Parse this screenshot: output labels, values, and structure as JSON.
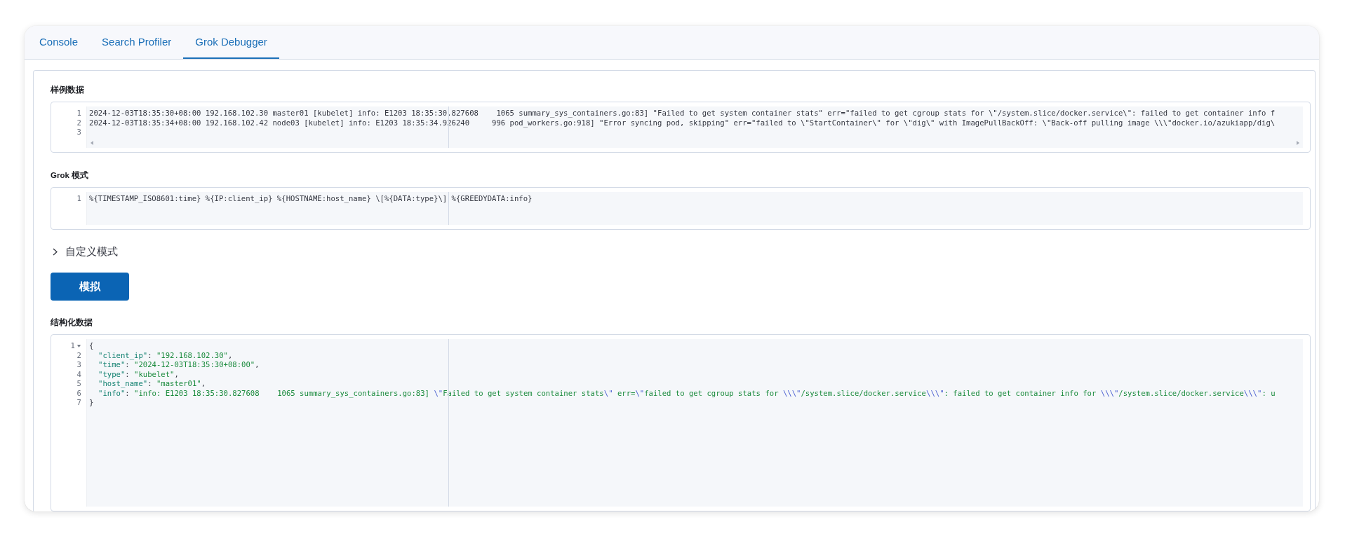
{
  "tabs": [
    {
      "label": "Console",
      "selected": false
    },
    {
      "label": "Search Profiler",
      "selected": false
    },
    {
      "label": "Grok Debugger",
      "selected": true
    }
  ],
  "sample_data": {
    "label": "样例数据",
    "lines": [
      {
        "number": "1",
        "text": "2024-12-03T18:35:30+08:00 192.168.102.30 master01 [kubelet] info: E1203 18:35:30.827608    1065 summary_sys_containers.go:83] \"Failed to get system container stats\" err=\"failed to get cgroup stats for \\\"/system.slice/docker.service\\\": failed to get container info f"
      },
      {
        "number": "2",
        "text": "2024-12-03T18:35:34+08:00 192.168.102.42 node03 [kubelet] info: E1203 18:35:34.926240     996 pod_workers.go:918] \"Error syncing pod, skipping\" err=\"failed to \\\"StartContainer\\\" for \\\"dig\\\" with ImagePullBackOff: \\\"Back-off pulling image \\\\\\\"docker.io/azukiapp/dig\\"
      },
      {
        "number": "3"
      }
    ]
  },
  "grok_pattern": {
    "label": "Grok 模式",
    "lines": [
      {
        "number": "1",
        "text": "%{TIMESTAMP_ISO8601:time} %{IP:client_ip} %{HOSTNAME:host_name} \\[%{DATA:type}\\] %{GREEDYDATA:info}"
      }
    ]
  },
  "custom_patterns": {
    "label": "自定义模式",
    "expanded": false
  },
  "simulate_button": {
    "label": "模拟"
  },
  "structured_data": {
    "label": "结构化数据",
    "lines": [
      {
        "number": "1",
        "expanded": true,
        "tokens": [
          {
            "kind": "punct",
            "text": "{"
          }
        ],
        "children": [
          {
            "number": "2",
            "tokens": [
              {
                "kind": "key",
                "text": "\"client_ip\""
              },
              {
                "kind": "punct",
                "text": ": "
              },
              {
                "kind": "string",
                "text": "\"192.168.102.30\""
              },
              {
                "kind": "punct",
                "text": ","
              }
            ]
          },
          {
            "number": "3",
            "tokens": [
              {
                "kind": "key",
                "text": "\"time\""
              },
              {
                "kind": "punct",
                "text": ": "
              },
              {
                "kind": "string",
                "text": "\"2024-12-03T18:35:30+08:00\""
              },
              {
                "kind": "punct",
                "text": ","
              }
            ]
          },
          {
            "number": "4",
            "tokens": [
              {
                "kind": "key",
                "text": "\"type\""
              },
              {
                "kind": "punct",
                "text": ": "
              },
              {
                "kind": "string",
                "text": "\"kubelet\""
              },
              {
                "kind": "punct",
                "text": ","
              }
            ]
          },
          {
            "number": "5",
            "tokens": [
              {
                "kind": "key",
                "text": "\"host_name\""
              },
              {
                "kind": "punct",
                "text": ": "
              },
              {
                "kind": "string",
                "text": "\"master01\""
              },
              {
                "kind": "punct",
                "text": ","
              }
            ]
          },
          {
            "number": "6",
            "tokens": [
              {
                "kind": "key",
                "text": "\"info\""
              },
              {
                "kind": "punct",
                "text": ": "
              },
              {
                "kind": "string",
                "text": "\"info: E1203 18:35:30.827608    1065 summary_sys_containers.go:83] "
              },
              {
                "kind": "escape",
                "text": "\\\""
              },
              {
                "kind": "string",
                "text": "Failed to get system container stats"
              },
              {
                "kind": "escape",
                "text": "\\\""
              },
              {
                "kind": "string",
                "text": " err="
              },
              {
                "kind": "escape",
                "text": "\\\""
              },
              {
                "kind": "string",
                "text": "failed to get cgroup stats for "
              },
              {
                "kind": "escape",
                "text": "\\\\\\\""
              },
              {
                "kind": "string",
                "text": "/system.slice/docker.service"
              },
              {
                "kind": "escape",
                "text": "\\\\\\\""
              },
              {
                "kind": "string",
                "text": ": failed to get container info for "
              },
              {
                "kind": "escape",
                "text": "\\\\\\\""
              },
              {
                "kind": "string",
                "text": "/system.slice/docker.service"
              },
              {
                "kind": "escape",
                "text": "\\\\\\\""
              },
              {
                "kind": "string",
                "text": ": u"
              }
            ]
          }
        ]
      },
      {
        "number": "7",
        "tokens": [
          {
            "kind": "punct",
            "text": "}"
          }
        ]
      }
    ]
  }
}
